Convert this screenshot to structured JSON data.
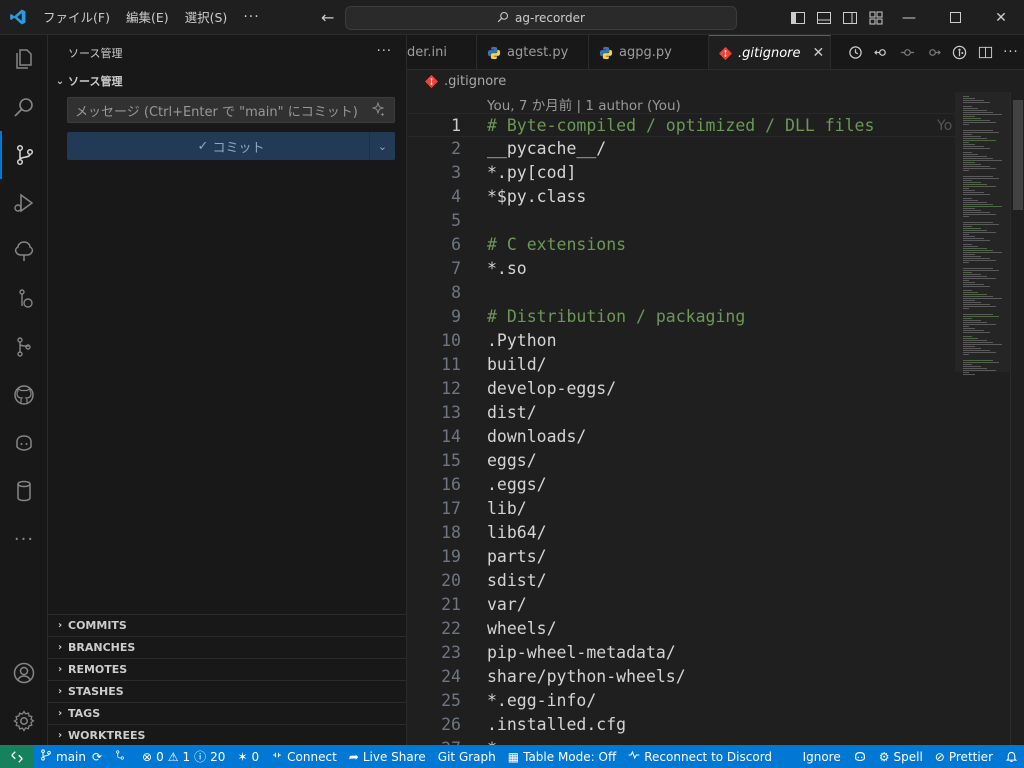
{
  "titlebar": {
    "menus": [
      "ファイル(F)",
      "編集(E)",
      "選択(S)"
    ],
    "more": "···",
    "command_center": "ag-recorder"
  },
  "sidebar": {
    "title": "ソース管理",
    "more": "···",
    "section_title": "ソース管理",
    "message_placeholder": "メッセージ (Ctrl+Enter で \"main\" にコミット)",
    "commit_label": "コミット",
    "bottom_sections": [
      "COMMITS",
      "BRANCHES",
      "REMOTES",
      "STASHES",
      "TAGS",
      "WORKTREES"
    ]
  },
  "tabs": [
    {
      "label": "der.ini",
      "icon": "settings-file-icon"
    },
    {
      "label": "agtest.py",
      "icon": "python-icon"
    },
    {
      "label": "agpg.py",
      "icon": "python-icon"
    },
    {
      "label": ".gitignore",
      "icon": "git-icon",
      "active": true
    }
  ],
  "breadcrumb": {
    "file": ".gitignore"
  },
  "editor": {
    "codelens": "You, 7 か月前 | 1 author (You)",
    "blame_inline": "Yo",
    "lines": [
      {
        "n": "1",
        "text": "# Byte-compiled / optimized / DLL files",
        "comment": true
      },
      {
        "n": "2",
        "text": "__pycache__/"
      },
      {
        "n": "3",
        "text": "*.py[cod]"
      },
      {
        "n": "4",
        "text": "*$py.class"
      },
      {
        "n": "5",
        "text": ""
      },
      {
        "n": "6",
        "text": "# C extensions",
        "comment": true
      },
      {
        "n": "7",
        "text": "*.so"
      },
      {
        "n": "8",
        "text": ""
      },
      {
        "n": "9",
        "text": "# Distribution / packaging",
        "comment": true
      },
      {
        "n": "10",
        "text": ".Python"
      },
      {
        "n": "11",
        "text": "build/"
      },
      {
        "n": "12",
        "text": "develop-eggs/"
      },
      {
        "n": "13",
        "text": "dist/"
      },
      {
        "n": "14",
        "text": "downloads/"
      },
      {
        "n": "15",
        "text": "eggs/"
      },
      {
        "n": "16",
        "text": ".eggs/"
      },
      {
        "n": "17",
        "text": "lib/"
      },
      {
        "n": "18",
        "text": "lib64/"
      },
      {
        "n": "19",
        "text": "parts/"
      },
      {
        "n": "20",
        "text": "sdist/"
      },
      {
        "n": "21",
        "text": "var/"
      },
      {
        "n": "22",
        "text": "wheels/"
      },
      {
        "n": "23",
        "text": "pip-wheel-metadata/"
      },
      {
        "n": "24",
        "text": "share/python-wheels/"
      },
      {
        "n": "25",
        "text": "*.egg-info/"
      },
      {
        "n": "26",
        "text": ".installed.cfg"
      },
      {
        "n": "27",
        "text": "*"
      }
    ]
  },
  "statusbar": {
    "branch": "main",
    "errors": "0",
    "warnings": "1",
    "infos": "20",
    "ports": "0",
    "connect": "Connect",
    "live_share": "Live Share",
    "git_graph": "Git Graph",
    "table_mode": "Table Mode: Off",
    "discord": "Reconnect to Discord",
    "ignore": "Ignore",
    "spell": "Spell",
    "prettier": "Prettier"
  },
  "colors": {
    "accent": "#0078d4",
    "remote": "#16825d",
    "comment": "#6a9955",
    "git": "#e8453c",
    "python_blue": "#3a75b0",
    "python_yellow": "#f6d14d"
  }
}
